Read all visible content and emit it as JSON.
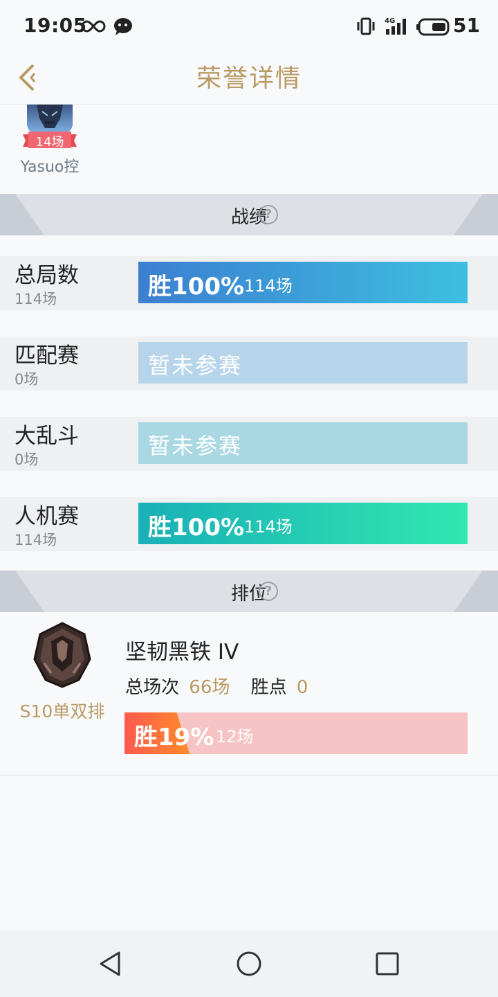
{
  "status_bar": {
    "time": "19:05",
    "network_label": "4G",
    "battery": "51",
    "icons": [
      "infinity-icon",
      "wechat-icon",
      "vibrate-icon",
      "signal-icon",
      "battery-icon"
    ]
  },
  "header": {
    "title": "荣誉详情",
    "back_icon": "chevron-left-icon"
  },
  "honor": {
    "count": "14场",
    "label": "Yasuo控"
  },
  "stats_section": {
    "title": "战绩",
    "help": "?",
    "rows": [
      {
        "name": "总局数",
        "count": "114场",
        "played": true,
        "win": "胜100%",
        "games": "114场",
        "win_rate": 1.0
      },
      {
        "name": "匹配赛",
        "count": "0场",
        "played": false,
        "none_text": "暂未参赛"
      },
      {
        "name": "大乱斗",
        "count": "0场",
        "played": false,
        "none_text": "暂未参赛"
      },
      {
        "name": "人机赛",
        "count": "114场",
        "played": true,
        "win": "胜100%",
        "games": "114场",
        "win_rate": 1.0
      }
    ]
  },
  "rank_section": {
    "title": "排位",
    "help": "?",
    "season": "S10单双排",
    "tier": "坚韧黑铁 IV",
    "total_label": "总场次",
    "total_value": "66场",
    "points_label": "胜点",
    "points_value": "0",
    "win": "胜19%",
    "games": "12场",
    "win_rate": 0.19
  },
  "colors": {
    "gold": "#b99962",
    "total_bar": [
      "#3c7fd1",
      "#3dbfe0"
    ],
    "match_bar": "#b7d5ea",
    "aram_bar": "#a9d8e3",
    "bot_bar": [
      "#19b0b7",
      "#31e8b0"
    ],
    "rank_fill": [
      "#ff5a4f",
      "#ff8a2a"
    ],
    "rank_track": "#f7c4c6"
  }
}
